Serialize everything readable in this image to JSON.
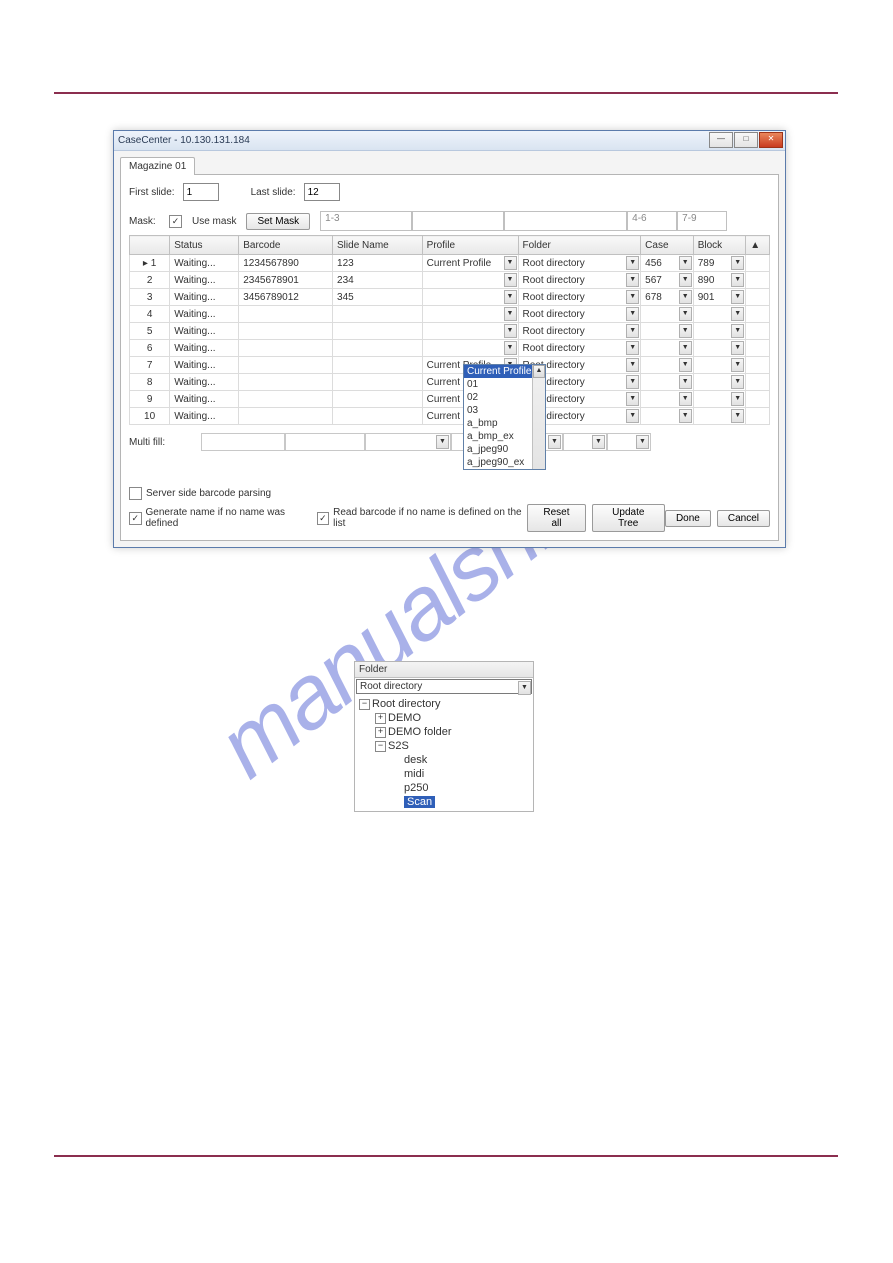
{
  "window": {
    "title": "CaseCenter - 10.130.131.184",
    "tab": "Magazine 01",
    "first_slide_label": "First slide:",
    "first_slide_value": "1",
    "last_slide_label": "Last slide:",
    "last_slide_value": "12",
    "mask_label": "Mask:",
    "use_mask_label": "Use mask",
    "set_mask_label": "Set Mask",
    "mask_cells": [
      "1-3",
      "",
      "",
      "4-6",
      "7-9"
    ],
    "columns": {
      "num": "",
      "status": "Status",
      "barcode": "Barcode",
      "slide": "Slide Name",
      "profile": "Profile",
      "folder": "Folder",
      "case": "Case",
      "block": "Block",
      "scroll": ""
    },
    "rows": [
      {
        "n": "1",
        "status": "Waiting...",
        "barcode": "1234567890",
        "slide": "123",
        "profile": "Current Profile",
        "folder": "Root directory",
        "case": "456",
        "block": "789"
      },
      {
        "n": "2",
        "status": "Waiting...",
        "barcode": "2345678901",
        "slide": "234",
        "profile": "",
        "folder": "Root directory",
        "case": "567",
        "block": "890"
      },
      {
        "n": "3",
        "status": "Waiting...",
        "barcode": "3456789012",
        "slide": "345",
        "profile": "",
        "folder": "Root directory",
        "case": "678",
        "block": "901"
      },
      {
        "n": "4",
        "status": "Waiting...",
        "barcode": "",
        "slide": "",
        "profile": "",
        "folder": "Root directory",
        "case": "",
        "block": ""
      },
      {
        "n": "5",
        "status": "Waiting...",
        "barcode": "",
        "slide": "",
        "profile": "",
        "folder": "Root directory",
        "case": "",
        "block": ""
      },
      {
        "n": "6",
        "status": "Waiting...",
        "barcode": "",
        "slide": "",
        "profile": "",
        "folder": "Root directory",
        "case": "",
        "block": ""
      },
      {
        "n": "7",
        "status": "Waiting...",
        "barcode": "",
        "slide": "",
        "profile": "Current Profile",
        "folder": "Root directory",
        "case": "",
        "block": ""
      },
      {
        "n": "8",
        "status": "Waiting...",
        "barcode": "",
        "slide": "",
        "profile": "Current Profile",
        "folder": "Root directory",
        "case": "",
        "block": ""
      },
      {
        "n": "9",
        "status": "Waiting...",
        "barcode": "",
        "slide": "",
        "profile": "Current Profile",
        "folder": "Root directory",
        "case": "",
        "block": ""
      },
      {
        "n": "10",
        "status": "Waiting...",
        "barcode": "",
        "slide": "",
        "profile": "Current Profile",
        "folder": "Root directory",
        "case": "",
        "block": ""
      }
    ],
    "profile_options": [
      "Current Profile",
      "01",
      "02",
      "03",
      "a_bmp",
      "a_bmp_ex",
      "a_jpeg90",
      "a_jpeg90_ex"
    ],
    "multi_fill_label": "Multi fill:",
    "server_side_label": "Server side barcode parsing",
    "generate_name_label": "Generate name if no name was defined",
    "read_barcode_label": "Read barcode if no name is defined on the list",
    "buttons": {
      "reset": "Reset all",
      "update": "Update Tree",
      "done": "Done",
      "cancel": "Cancel"
    }
  },
  "folder_popup": {
    "header": "Folder",
    "selected": "Root directory",
    "tree": {
      "root": "Root directory",
      "children": [
        "DEMO",
        "DEMO folder",
        "S2S"
      ],
      "s2s_children": [
        "desk",
        "midi",
        "p250",
        "Scan"
      ]
    }
  },
  "watermark": "manualshive.com"
}
